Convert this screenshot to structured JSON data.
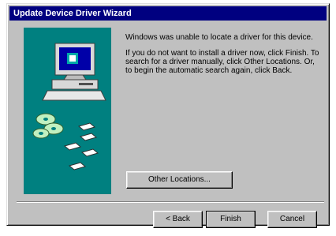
{
  "window": {
    "title": "Update Device Driver Wizard"
  },
  "content": {
    "message1": "Windows was unable to locate a driver for this device.",
    "message2": "If you do not want to install a driver now, click Finish. To search for a driver manually, click Other Locations. Or, to begin the automatic search again, click Back."
  },
  "buttons": {
    "other_locations": "Other Locations...",
    "back": "< Back",
    "finish": "Finish",
    "cancel": "Cancel"
  },
  "colors": {
    "title_bar": "#000080",
    "art_panel": "#008080",
    "dialog_face": "#c0c0c0"
  }
}
